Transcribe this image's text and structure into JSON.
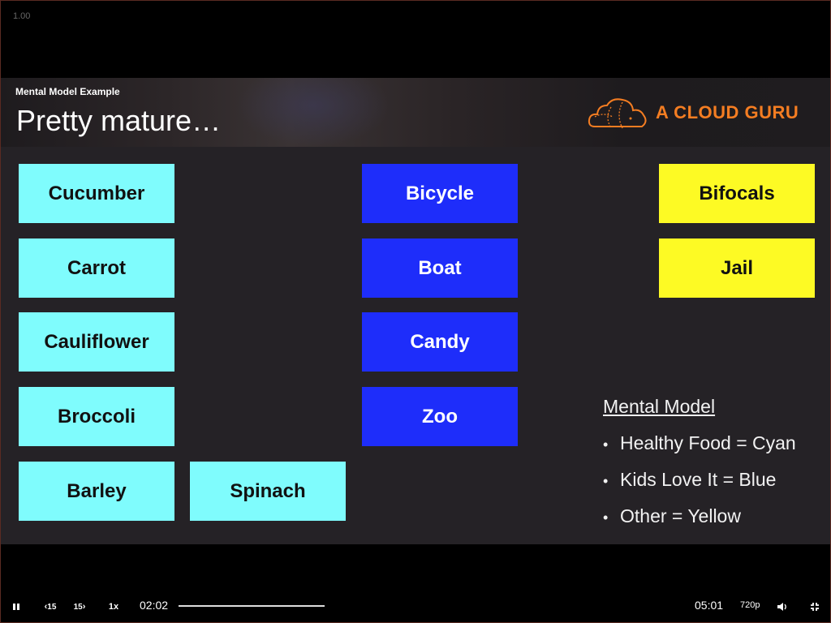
{
  "player": {
    "speed_indicator": "1.00",
    "current_time": "02:02",
    "total_time": "05:01",
    "playback_rate": "1x",
    "quality": "720p",
    "skip_back_label": "15",
    "skip_forward_label": "15",
    "progress": 0.0
  },
  "slide": {
    "section_label": "Mental Model Example",
    "title": "Pretty mature…",
    "brand": "A CLOUD GURU",
    "columns": {
      "cyan": [
        "Cucumber",
        "Carrot",
        "Cauliflower",
        "Broccoli",
        "Barley",
        "Spinach"
      ],
      "blue": [
        "Bicycle",
        "Boat",
        "Candy",
        "Zoo"
      ],
      "yellow": [
        "Bifocals",
        "Jail"
      ]
    },
    "legend": {
      "title": "Mental Model",
      "items": [
        "Healthy Food = Cyan",
        "Kids Love It = Blue",
        "Other = Yellow"
      ]
    }
  },
  "colors": {
    "cyan": "#7ffcfd",
    "blue": "#1e2dfa",
    "yellow": "#fdfa24",
    "brand": "#f47d22",
    "slide_bg": "#252226"
  }
}
